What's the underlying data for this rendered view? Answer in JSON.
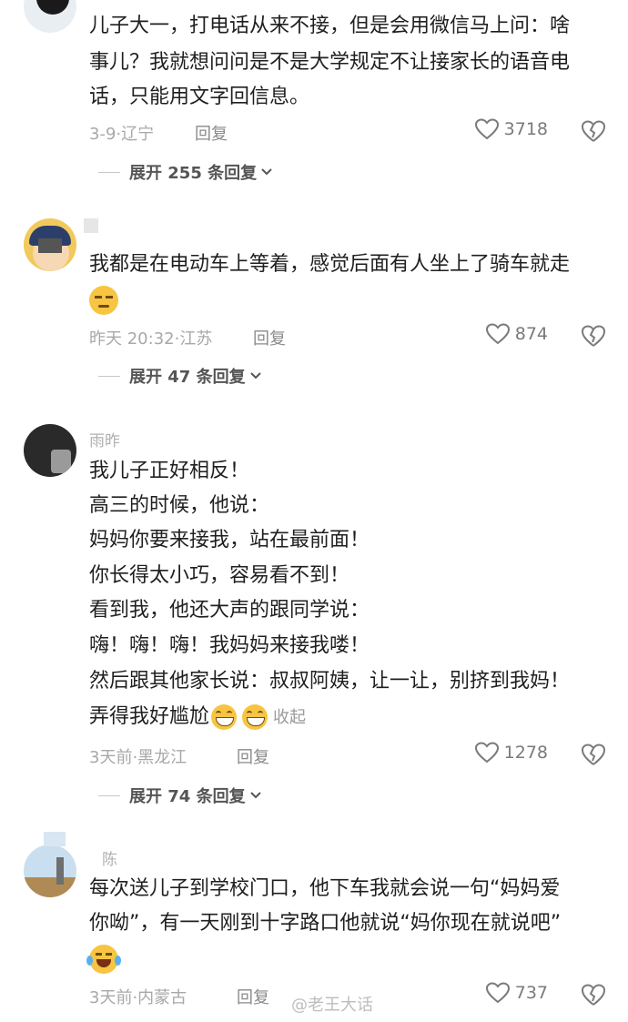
{
  "comments": [
    {
      "lines": [
        "儿子大一，打电话从来不接，但是会用微信马上问：啥",
        "事儿？我就想问问是不是大学规定不让接家长的语音电",
        "话，只能用文字回信息。"
      ],
      "time_location": "3-9·辽宁",
      "reply_label": "回复",
      "likes": "3718",
      "expand_label": "展开 255 条回复"
    },
    {
      "lines": [
        "我都是在电动车上等着，感觉后面有人坐上了骑车就走"
      ],
      "time_location": "昨天 20:32·江苏",
      "reply_label": "回复",
      "likes": "874",
      "expand_label": "展开 47 条回复"
    },
    {
      "username": "雨昨",
      "lines": [
        "我儿子正好相反！",
        "高三的时候，他说：",
        "妈妈你要来接我，站在最前面！",
        "你长得太小巧，容易看不到！",
        "看到我，他还大声的跟同学说：",
        "嗨！嗨！嗨！我妈妈来接我喽！",
        "然后跟其他家长说：叔叔阿姨，让一让，别挤到我妈！",
        "弄得我好尴尬"
      ],
      "collapse_label": "收起",
      "time_location": "3天前·黑龙江",
      "reply_label": "回复",
      "likes": "1278",
      "expand_label": "展开 74 条回复"
    },
    {
      "username": "陈",
      "lines": [
        "每次送儿子到学校门口，他下车我就会说一句“妈妈爱",
        "你呦”，有一天刚到十字路口他就说“妈你现在就说吧”"
      ],
      "time_location": "3天前·内蒙古",
      "reply_label": "回复",
      "likes": "737"
    }
  ],
  "watermark": "@老王大话",
  "icons": {
    "like": "heart-outline-icon",
    "dislike": "broken-heart-icon",
    "expand": "chevron-down-icon"
  },
  "colors": {
    "text": "#1f1f1f",
    "meta": "#a8a8a8",
    "icon": "#7a7a7a"
  }
}
